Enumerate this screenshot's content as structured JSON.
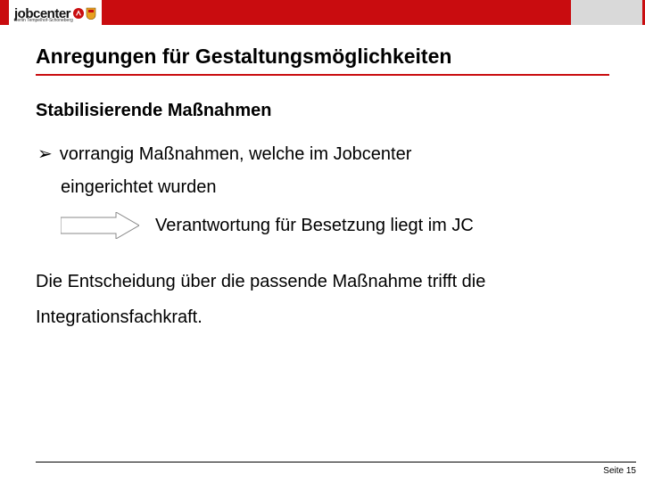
{
  "logo": {
    "text": "jobcenter",
    "subtext": "Berlin Tempelhof-Schöneberg"
  },
  "title": "Anregungen für Gestaltungsmöglichkeiten",
  "subtitle": "Stabilisierende Maßnahmen",
  "bullet": {
    "marker": "➢",
    "line1": "vorrangig Maßnahmen, welche im Jobcenter",
    "line2": "eingerichtet wurden"
  },
  "arrow_label": "Verantwortung für Besetzung liegt im JC",
  "conclusion": "Die Entscheidung über die passende Maßnahme trifft die Integrationsfachkraft.",
  "footer": "Seite 15"
}
